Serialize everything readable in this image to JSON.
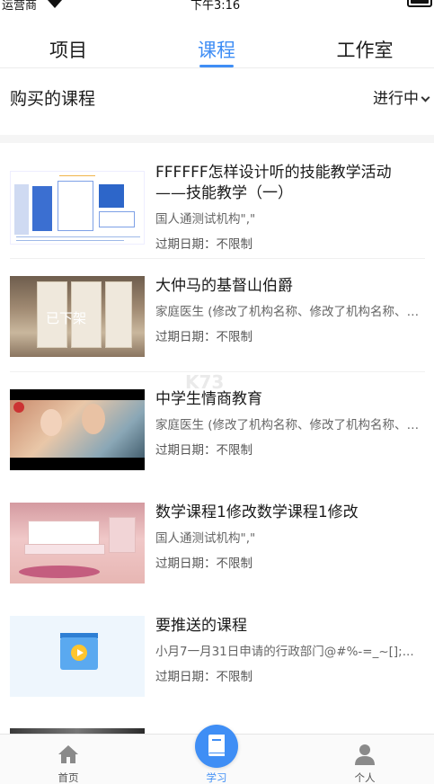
{
  "status_bar": {
    "carrier": "运营商",
    "time": "下午3:16"
  },
  "top_tabs": [
    {
      "label": "项目",
      "active": false
    },
    {
      "label": "课程",
      "active": true
    },
    {
      "label": "工作室",
      "active": false
    }
  ],
  "accent_color": "#3f8ef5",
  "section": {
    "title": "购买的课程",
    "filter": "进行中"
  },
  "courses": [
    {
      "title_line1": "FFFFFF怎样设计听的技能教学活动",
      "title_line2": "——技能教学（一）",
      "subtitle": "国人通测试机构\",\"",
      "expire": "过期日期：不限制",
      "thumb": "diagram"
    },
    {
      "title_line1": "大仲马的基督山伯爵",
      "subtitle": "家庭医生 (修改了机构名称、修改了机构名称、修改了机构名称)",
      "expire": "过期日期：不限制",
      "thumb": "room",
      "thumb_label": "已下架"
    },
    {
      "title_line1": "中学生情商教育",
      "subtitle": "家庭医生 (修改了机构名称、修改了机构名称、修改了机构名称)",
      "expire": "过期日期：不限制",
      "thumb": "movie"
    },
    {
      "title_line1": "数学课程1修改数学课程1修改",
      "subtitle": "国人通测试机构\",\"",
      "expire": "过期日期：不限制",
      "thumb": "bedroom"
    },
    {
      "title_line1": "要推送的课程",
      "subtitle": "小月7一月31日申请的行政部门@#%-=_~[];...",
      "expire": "过期日期：不限制",
      "thumb": "video"
    }
  ],
  "watermark": {
    "logo": "K73",
    "text": "游戏之家"
  },
  "bottom_nav": [
    {
      "label": "首页",
      "icon": "home-icon",
      "active": false
    },
    {
      "label": "学习",
      "icon": "book-icon",
      "active": true
    },
    {
      "label": "个人",
      "icon": "person-icon",
      "active": false
    }
  ]
}
